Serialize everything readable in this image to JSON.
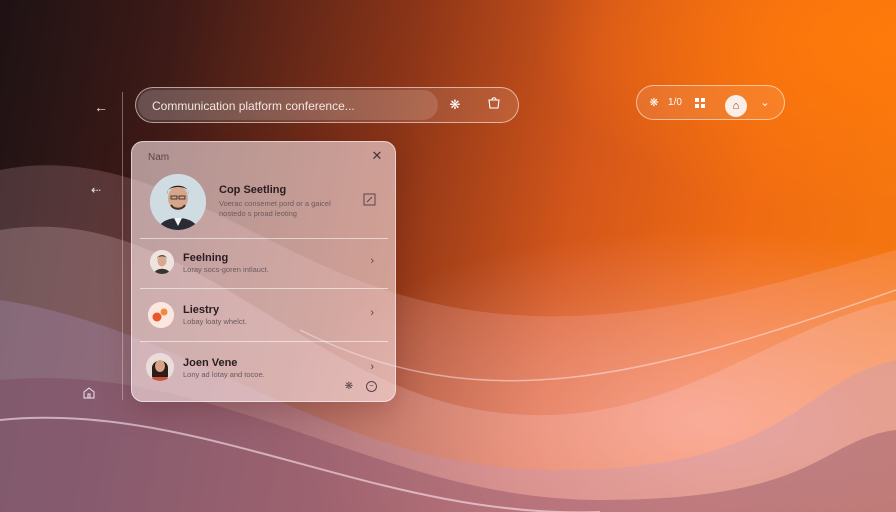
{
  "nav": {
    "back_icon": "arrow-left-icon",
    "forward_icon": "arrow-left-small-icon",
    "home_icon": "home-outline-icon"
  },
  "search": {
    "placeholder": "Communication platform conference...",
    "icons": [
      "settings-spark-icon",
      "bag-icon"
    ]
  },
  "toolbar": {
    "item1_icon": "sparkle-icon",
    "item1_label": "1/0",
    "item2_icon": "grid-icon",
    "item3_icon": "home-icon",
    "item4_label": "⌄"
  },
  "panel": {
    "title": "Nam",
    "close_icon": "close-icon",
    "contacts": [
      {
        "name": "Cop Seetling",
        "desc_line1": "Voerac consemet pord or a gaicel",
        "desc_line2": "nostedo s proad leoting",
        "action_icon": "edit-square-icon"
      },
      {
        "name": "Feelning",
        "desc": "Loray socs-goren intlauct.",
        "chevron": "›"
      },
      {
        "name": "Liestry",
        "desc": "Lobay loaty whelct.",
        "chevron": "›"
      },
      {
        "name": "Joen Vene",
        "desc": "Lony ad lotay and tocoe.",
        "chevron": "›"
      }
    ],
    "footer_icons": [
      "settings-icon",
      "minus-circle-icon"
    ]
  },
  "colors": {
    "accent": "#f5790f",
    "panel_bg": "#f8e0e2",
    "text_dark": "#2a1c20"
  }
}
